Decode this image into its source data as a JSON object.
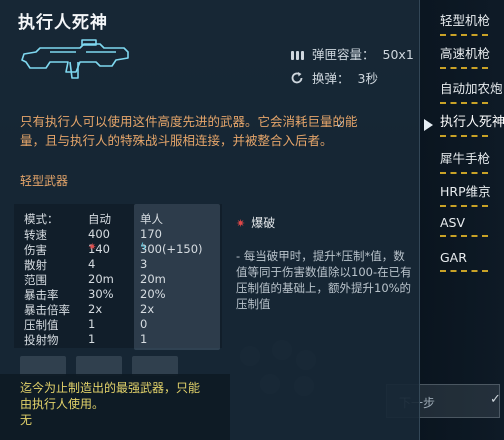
{
  "title": "执行人死神",
  "ammo": {
    "label": "弹匣容量：",
    "value": "50x1",
    "icon": "ammo-bullets-icon"
  },
  "reload": {
    "label": "换弹：",
    "value": "3秒",
    "icon": "reload-icon"
  },
  "description": "只有执行人可以使用这件高度先进的武器。它会消耗巨量的能量，且与执行人的特殊战斗服相连接，并被整合入后者。",
  "weapon_type": "轻型武器",
  "stats": {
    "headers": {
      "name": "模式：",
      "auto": "自动",
      "single": "单人"
    },
    "rows": [
      {
        "name": "转速",
        "auto": "400",
        "single": "170"
      },
      {
        "name": "伤害",
        "auto": "140",
        "single": "300(+150)"
      },
      {
        "name": "散射",
        "auto": "4",
        "single": "3"
      },
      {
        "name": "范围",
        "auto": "20m",
        "single": "20m"
      },
      {
        "name": "暴击率",
        "auto": "30%",
        "single": "20%"
      },
      {
        "name": "暴击倍率",
        "auto": "2x",
        "single": "2x"
      },
      {
        "name": "压制值",
        "auto": "1",
        "single": "0"
      },
      {
        "name": "投射物",
        "auto": "1",
        "single": "1"
      }
    ]
  },
  "perk": {
    "title": "爆破",
    "description": "- 每当破甲时，提升*压制*值，数值等同于伤害数值除以100-在已有压制值的基础上，额外提升10%的压制值"
  },
  "flavor_text": "迄今为止制造出的最强武器，只能由执行人使用。",
  "footer_value": "无",
  "weapon_list": [
    {
      "label": "轻型机枪"
    },
    {
      "label": "高速机枪"
    },
    {
      "label": "自动加农炮"
    },
    {
      "label": "执行人死神"
    },
    {
      "label": "犀牛手枪"
    },
    {
      "label": "HRP维京"
    },
    {
      "label": "ASV"
    },
    {
      "label": "GAR"
    }
  ],
  "next_button": "下一步",
  "colors": {
    "accent_orange": "#e5a56a",
    "flavor_yellow": "#e3d36a",
    "list_underline": "#c9a227",
    "crit_red": "#e05050",
    "shield_cyan": "#5cc8e0"
  }
}
